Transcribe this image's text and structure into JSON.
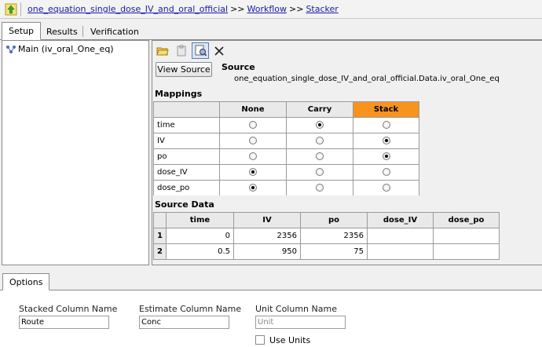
{
  "breadcrumb": {
    "items": [
      "one_equation_single_dose_IV_and_oral_official",
      "Workflow",
      "Stacker"
    ],
    "separator": ">>"
  },
  "tabs": [
    "Setup",
    "Results",
    "Verification"
  ],
  "tree": {
    "node_label": "Main (iv_oral_One_eq)"
  },
  "toolbar": {
    "icons": [
      "open-folder-icon",
      "paste-icon",
      "settings-icon",
      "close-icon"
    ]
  },
  "source": {
    "button_label": "View Source",
    "title": "Source",
    "value": "one_equation_single_dose_IV_and_oral_official.Data.iv_oral_One_eq"
  },
  "mappings": {
    "title": "Mappings",
    "columns": [
      "None",
      "Carry",
      "Stack"
    ],
    "rows": [
      {
        "name": "time",
        "selected": "Carry"
      },
      {
        "name": "IV",
        "selected": "Stack"
      },
      {
        "name": "po",
        "selected": "Stack"
      },
      {
        "name": "dose_IV",
        "selected": "None"
      },
      {
        "name": "dose_po",
        "selected": "None"
      }
    ],
    "stack_color": "#f8941d"
  },
  "source_data": {
    "title": "Source Data",
    "columns": [
      "time",
      "IV",
      "po",
      "dose_IV",
      "dose_po"
    ],
    "rows": [
      {
        "n": "1",
        "cells": [
          "0",
          "2356",
          "2356",
          "",
          ""
        ]
      },
      {
        "n": "2",
        "cells": [
          "0.5",
          "950",
          "75",
          "",
          ""
        ]
      }
    ]
  },
  "options": {
    "tab_label": "Options",
    "stacked_label": "Stacked Column Name",
    "stacked_value": "Route",
    "estimate_label": "Estimate Column Name",
    "estimate_value": "Conc",
    "unit_label": "Unit Column Name",
    "unit_placeholder": "Unit",
    "use_units_label": "Use Units",
    "use_units_checked": false
  }
}
